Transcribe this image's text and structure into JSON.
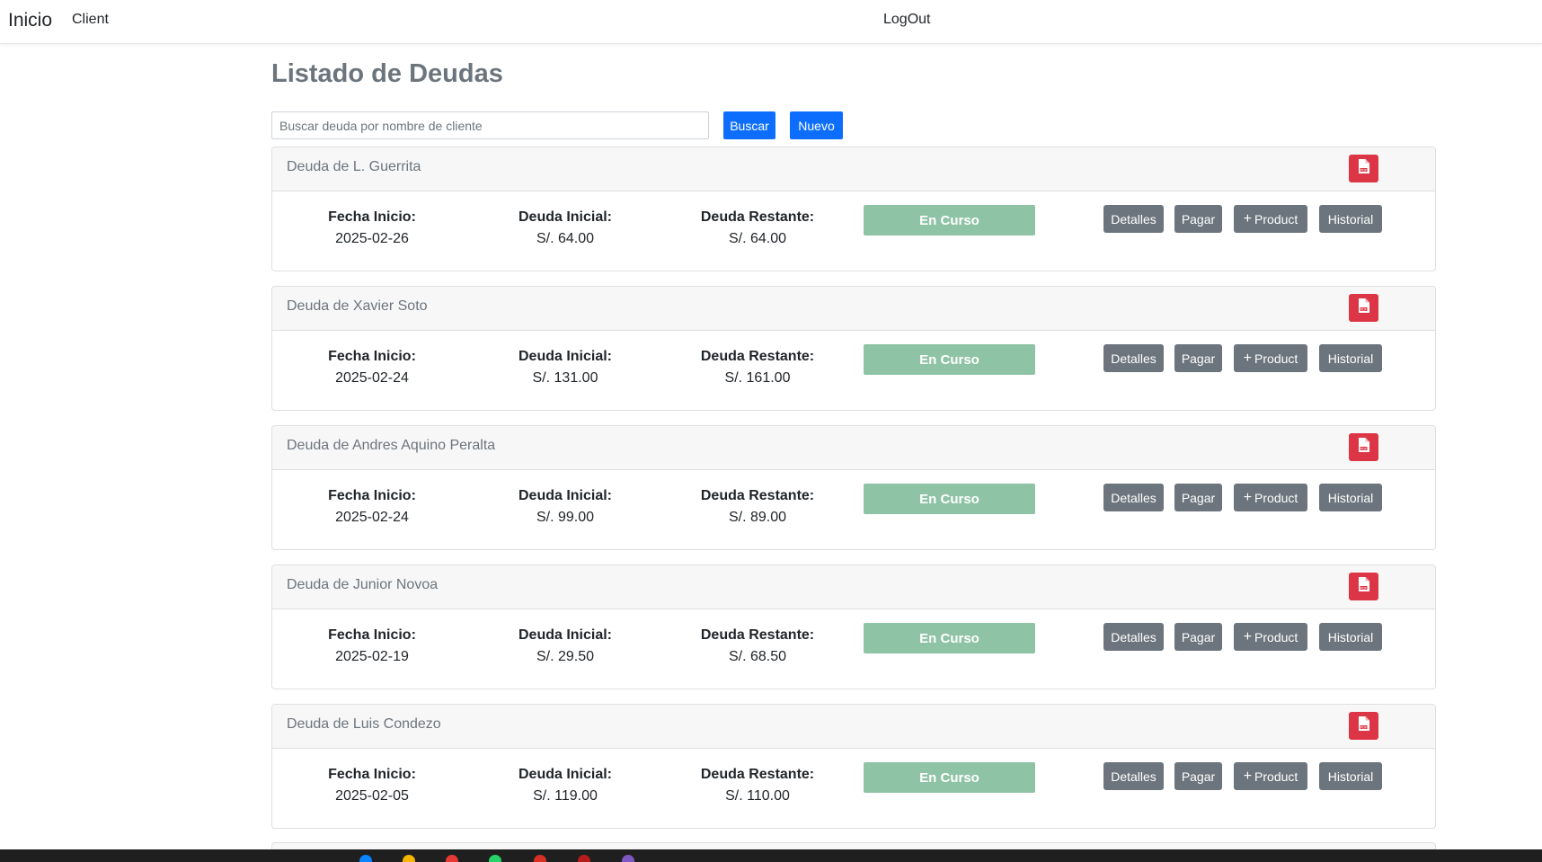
{
  "nav": {
    "brand": "Inicio",
    "client": "Client",
    "logout": "LogOut"
  },
  "page": {
    "title": "Listado de Deudas"
  },
  "search": {
    "placeholder": "Buscar deuda por nombre de cliente",
    "value": "",
    "buscar": "Buscar",
    "nuevo": "Nuevo"
  },
  "labels": {
    "fecha_inicio": "Fecha Inicio:",
    "deuda_inicial": "Deuda Inicial:",
    "deuda_restante": "Deuda Restante:",
    "detalles": "Detalles",
    "pagar": "Pagar",
    "product": "Product",
    "historial": "Historial"
  },
  "icons": {
    "pdf": "file-pdf-icon",
    "plus": "plus-icon"
  },
  "colors": {
    "primary": "#0d6efd",
    "secondary": "#6c757d",
    "danger": "#dc3545",
    "status": "#8fc3a5"
  },
  "debts": [
    {
      "title": "Deuda de L. Guerrita",
      "fecha_inicio": "2025-02-26",
      "deuda_inicial": "S/. 64.00",
      "deuda_restante": "S/. 64.00",
      "status": "En Curso"
    },
    {
      "title": "Deuda de Xavier Soto",
      "fecha_inicio": "2025-02-24",
      "deuda_inicial": "S/. 131.00",
      "deuda_restante": "S/. 161.00",
      "status": "En Curso"
    },
    {
      "title": "Deuda de Andres Aquino Peralta",
      "fecha_inicio": "2025-02-24",
      "deuda_inicial": "S/. 99.00",
      "deuda_restante": "S/. 89.00",
      "status": "En Curso"
    },
    {
      "title": "Deuda de Junior Novoa",
      "fecha_inicio": "2025-02-19",
      "deuda_inicial": "S/. 29.50",
      "deuda_restante": "S/. 68.50",
      "status": "En Curso"
    },
    {
      "title": "Deuda de Luis Condezo",
      "fecha_inicio": "2025-02-05",
      "deuda_inicial": "S/. 119.00",
      "deuda_restante": "S/. 110.00",
      "status": "En Curso"
    }
  ]
}
